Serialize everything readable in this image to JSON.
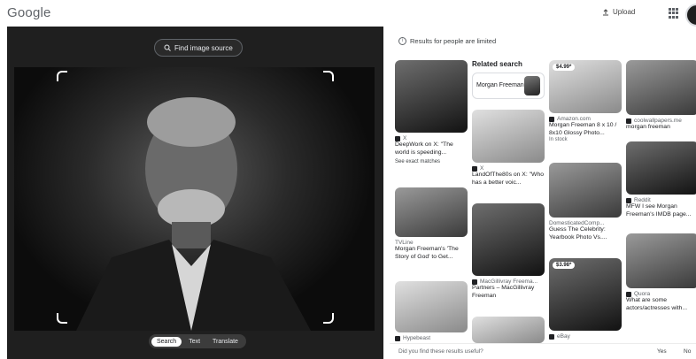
{
  "header": {
    "logo": "Google",
    "upload_label": "Upload"
  },
  "viewer": {
    "find_source_label": "Find image source",
    "modes": [
      "Search",
      "Text",
      "Translate"
    ],
    "active_mode": "Search"
  },
  "results": {
    "notice": "Results for people are limited",
    "related_title": "Related search",
    "related_item": "Morgan Freeman",
    "col1": [
      {
        "source": "X",
        "title": "DeepWork on X: \"The world is speeding...",
        "exact": "See exact matches"
      },
      {
        "source": "TVLine",
        "title": "Morgan Freeman's 'The Story of God' to Get..."
      },
      {
        "source": "Hypebeast",
        "title": ""
      }
    ],
    "col2": [
      {
        "source": "X",
        "title": "LandOfThe80s on X: \"Who has a better voic..."
      },
      {
        "source": "MacGillivray Freema...",
        "title": "Partners – MacGillivray Freeman"
      }
    ],
    "col3": [
      {
        "price": "$4.99*",
        "source": "Amazon.com",
        "title": "Morgan Freeman 8 x 10 / 8x10 Glossy Photo...",
        "stock": "In stock"
      },
      {
        "source": "DomesticatedComp...",
        "title": "Guess The Celebrity: Yearbook Photo Vs...."
      },
      {
        "price": "$3.98*",
        "source": "eBay",
        "title": ""
      }
    ],
    "col4": [
      {
        "source": "coolwallpapers.me",
        "title": "morgan freeman"
      },
      {
        "source": "Reddit",
        "title": "MFW I see Morgan Freeman's IMDB page..."
      },
      {
        "source": "Quora",
        "title": "What are some actors/actresses with..."
      }
    ]
  },
  "feedback": {
    "question": "Did you find these results useful?",
    "yes": "Yes",
    "no": "No"
  }
}
